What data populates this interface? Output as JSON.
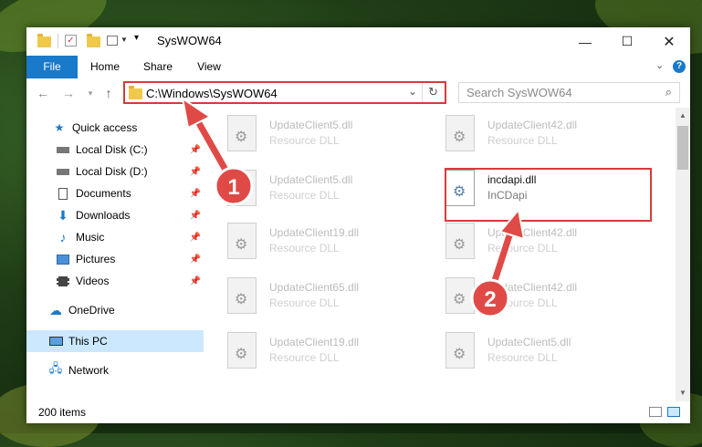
{
  "window": {
    "title": "SysWOW64"
  },
  "ribbon": {
    "tabs": [
      "File",
      "Home",
      "Share",
      "View"
    ]
  },
  "address_bar": {
    "path": "C:\\Windows\\SysWOW64"
  },
  "search": {
    "placeholder": "Search SysWOW64"
  },
  "sidebar": {
    "items": [
      {
        "label": "Quick access",
        "icon": "star-icon"
      },
      {
        "label": "Local Disk (C:)",
        "icon": "drive-icon",
        "pinned": true
      },
      {
        "label": "Local Disk (D:)",
        "icon": "drive-icon",
        "pinned": true
      },
      {
        "label": "Documents",
        "icon": "documents-icon",
        "pinned": true
      },
      {
        "label": "Downloads",
        "icon": "downloads-icon",
        "pinned": true
      },
      {
        "label": "Music",
        "icon": "music-icon",
        "pinned": true
      },
      {
        "label": "Pictures",
        "icon": "pictures-icon",
        "pinned": true
      },
      {
        "label": "Videos",
        "icon": "videos-icon",
        "pinned": true
      },
      {
        "label": "OneDrive",
        "icon": "cloud-icon"
      },
      {
        "label": "This PC",
        "icon": "computer-icon",
        "selected": true
      },
      {
        "label": "Network",
        "icon": "network-icon"
      }
    ]
  },
  "files": [
    {
      "name": "UpdateClient5.dll",
      "type": "Resource DLL"
    },
    {
      "name": "UpdateClient42.dll",
      "type": "Resource DLL"
    },
    {
      "name": "UpdateClient5.dll",
      "type": "Resource DLL"
    },
    {
      "name": "incdapi.dll",
      "type": "InCDapi",
      "highlighted": true
    },
    {
      "name": "UpdateClient19.dll",
      "type": "Resource DLL"
    },
    {
      "name": "UpdateClient42.dll",
      "type": "Resource DLL"
    },
    {
      "name": "UpdateClient65.dll",
      "type": "Resource DLL"
    },
    {
      "name": "UpdateClient42.dll",
      "type": "Resource DLL"
    },
    {
      "name": "UpdateClient19.dll",
      "type": "Resource DLL"
    },
    {
      "name": "UpdateClient5.dll",
      "type": "Resource DLL"
    }
  ],
  "status": {
    "item_count": "200 items"
  },
  "annotations": {
    "step1": "1",
    "step2": "2",
    "color": "#e04a46"
  }
}
